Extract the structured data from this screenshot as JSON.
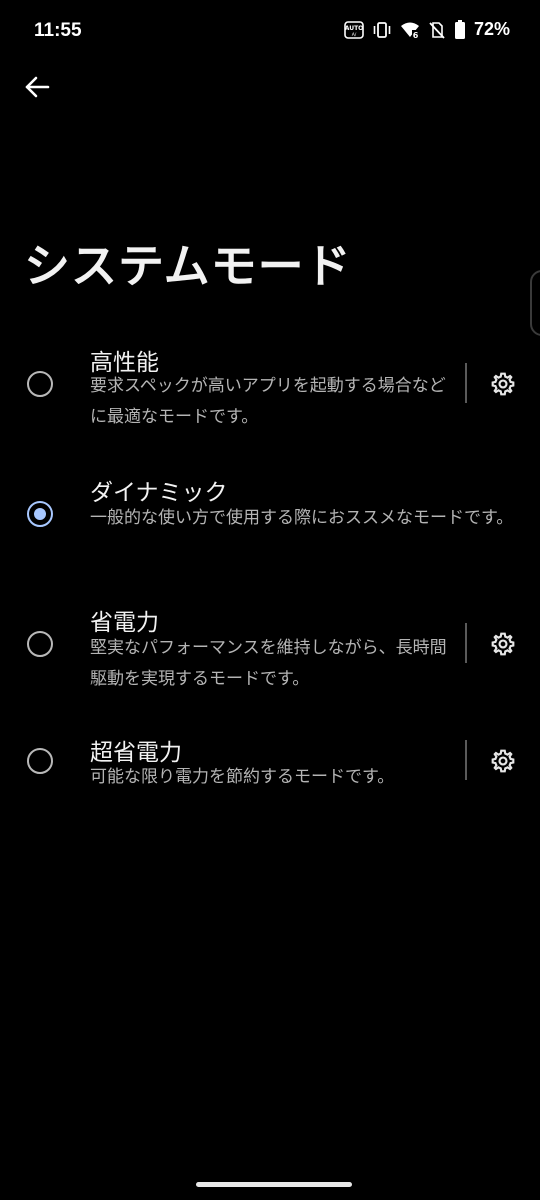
{
  "status_bar": {
    "time": "11:55",
    "battery_percent": "72%",
    "icons": [
      "auto-brightness-icon",
      "vibrate-icon",
      "wifi-icon",
      "no-sim-icon",
      "battery-icon"
    ]
  },
  "header": {
    "back_icon": "arrow-left-icon",
    "title": "システムモード"
  },
  "modes": [
    {
      "title": "高性能",
      "description": "要求スペックが高いアプリを起動する場合などに最適なモードです。",
      "selected": false,
      "has_settings": true
    },
    {
      "title": "ダイナミック",
      "description": "一般的な使い方で使用する際におススメなモードです。",
      "selected": true,
      "has_settings": false
    },
    {
      "title": "省電力",
      "description": "堅実なパフォーマンスを維持しながら、長時間駆動を実現するモードです。",
      "selected": false,
      "has_settings": true
    },
    {
      "title": "超省電力",
      "description": "可能な限り電力を節約するモードです。",
      "selected": false,
      "has_settings": true
    }
  ],
  "colors": {
    "background": "#000000",
    "accent": "#a8c8ff",
    "text_primary": "#f2f2f2",
    "text_secondary": "#b4b4b4"
  }
}
